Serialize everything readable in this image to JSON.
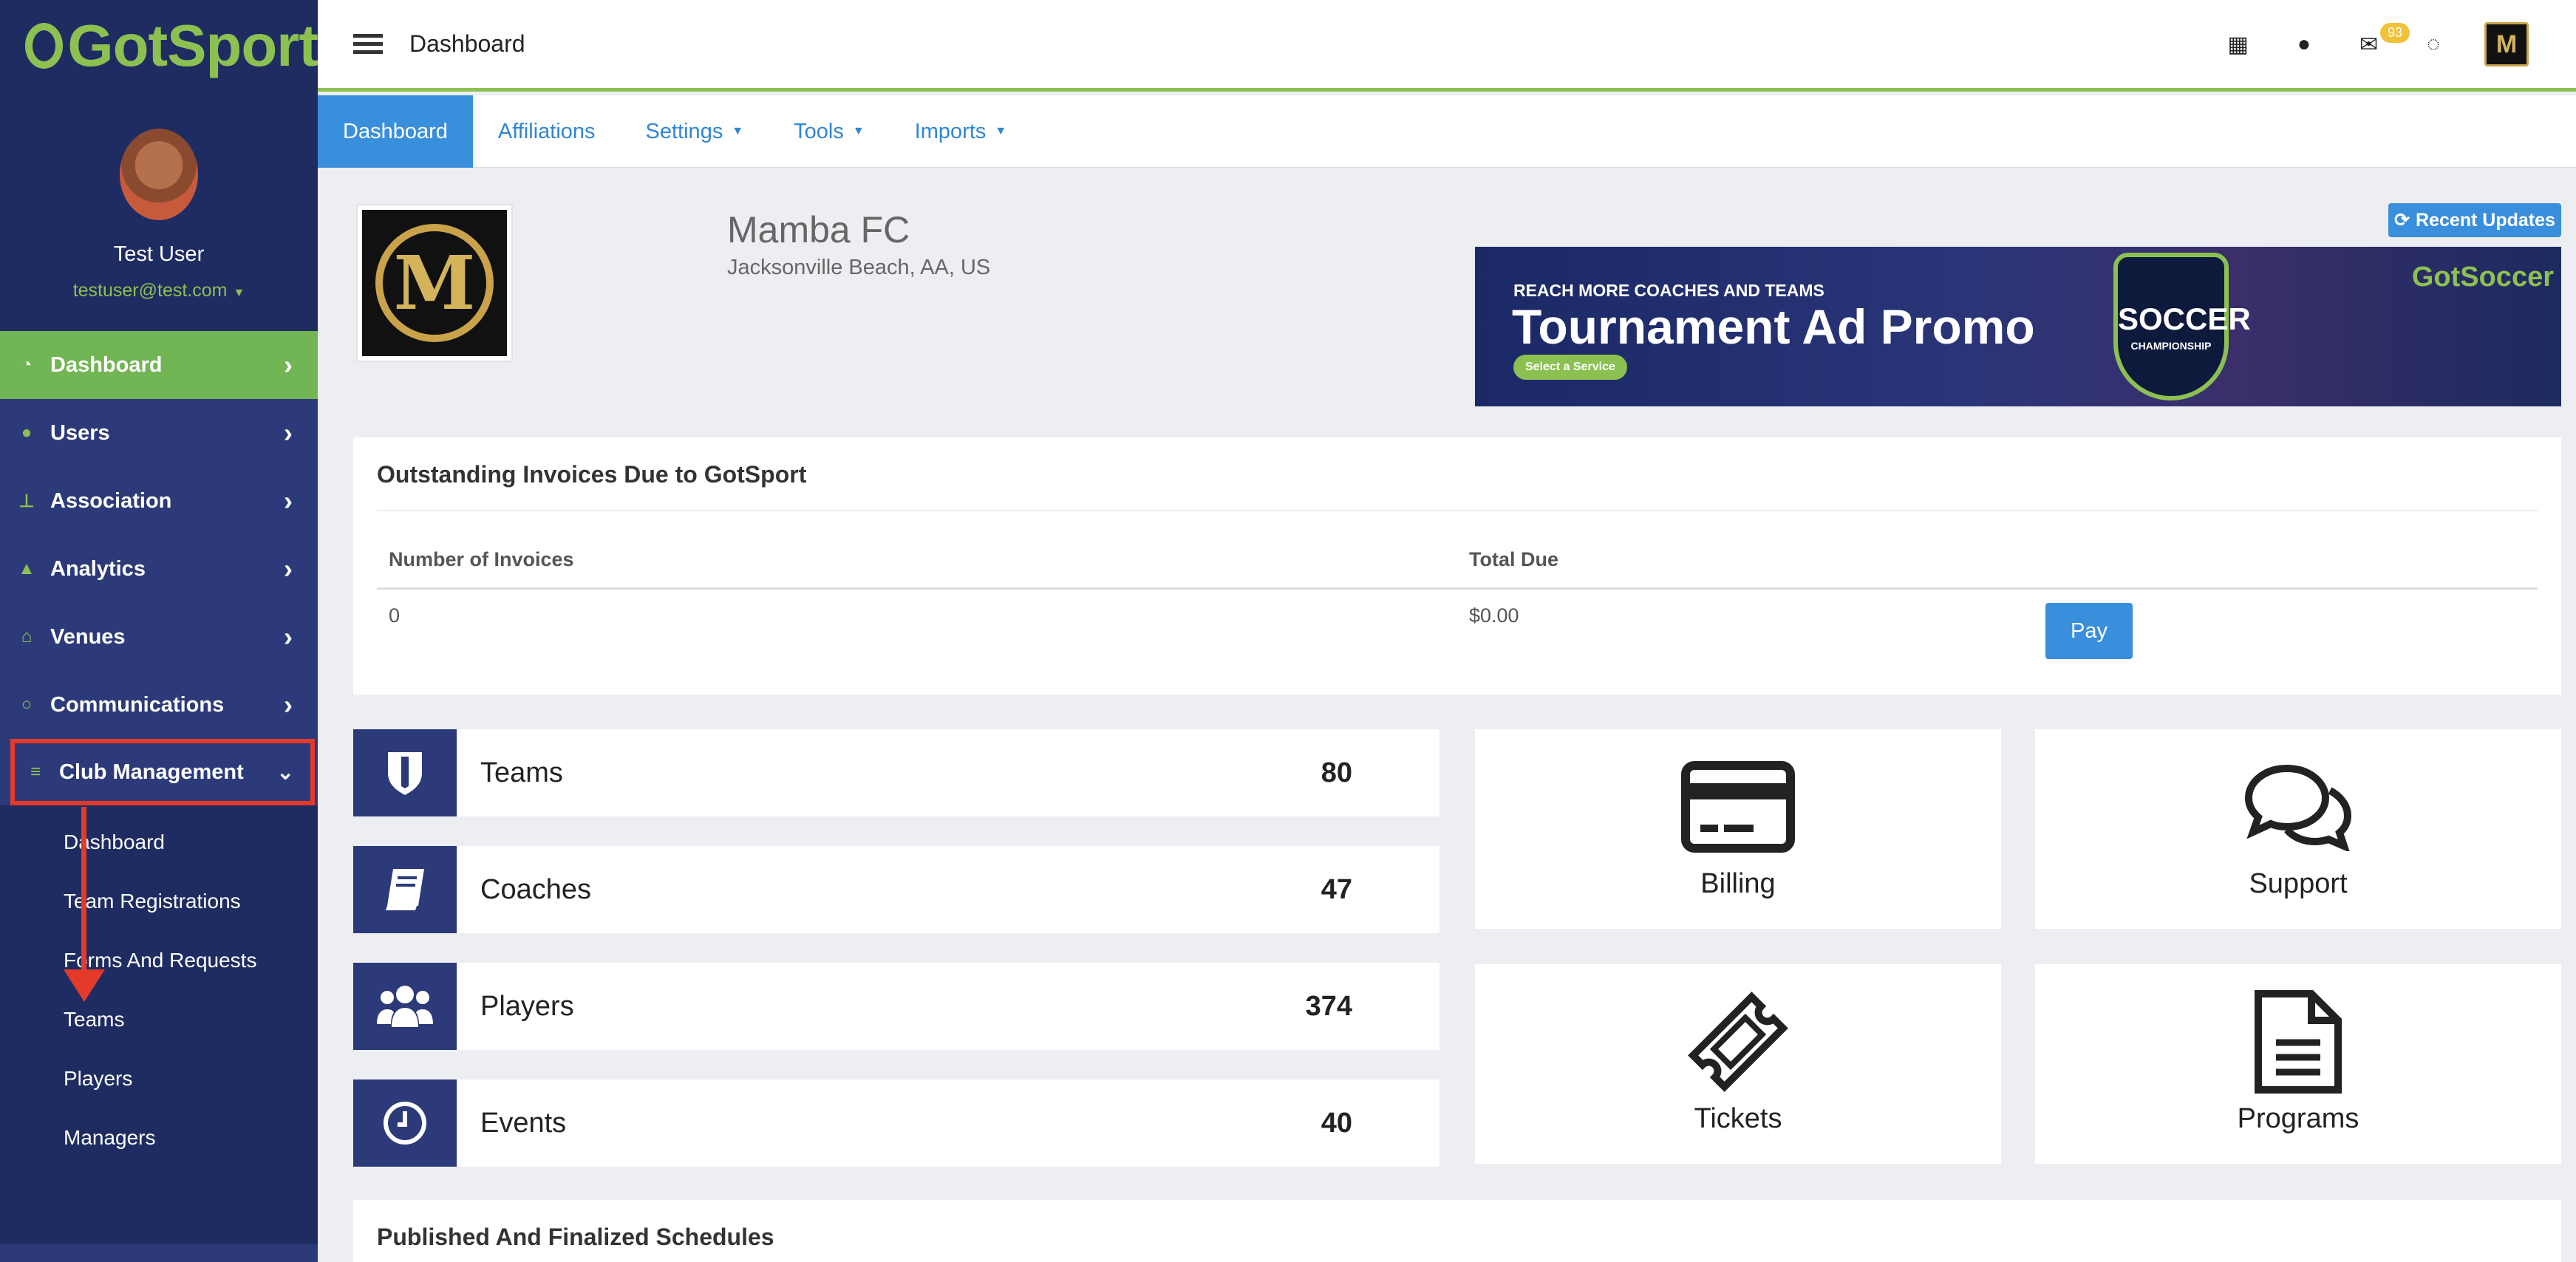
{
  "app": {
    "logo_text": "GotSport"
  },
  "user": {
    "name": "Test User",
    "email": "testuser@test.com"
  },
  "sidebar": {
    "items": [
      {
        "label": "Dashboard",
        "icon": "dashboard-icon"
      },
      {
        "label": "Users",
        "icon": "users-icon"
      },
      {
        "label": "Association",
        "icon": "sitemap-icon"
      },
      {
        "label": "Analytics",
        "icon": "chart-icon"
      },
      {
        "label": "Venues",
        "icon": "home-icon"
      },
      {
        "label": "Communications",
        "icon": "comments-icon"
      },
      {
        "label": "Club Management",
        "icon": "list-icon"
      }
    ],
    "submenu": [
      "Dashboard",
      "Team Registrations",
      "Forms And Requests",
      "Teams",
      "Players",
      "Managers"
    ]
  },
  "topbar": {
    "title": "Dashboard",
    "mail_badge": "93"
  },
  "tabs": [
    {
      "label": "Dashboard"
    },
    {
      "label": "Affiliations"
    },
    {
      "label": "Settings"
    },
    {
      "label": "Tools"
    },
    {
      "label": "Imports"
    }
  ],
  "club": {
    "name": "Mamba FC",
    "location": "Jacksonville Beach, AA, US",
    "logo_letter": "M"
  },
  "recent_updates_label": "Recent Updates",
  "ad": {
    "small": "REACH MORE COACHES AND TEAMS",
    "big": "Tournament Ad Promo",
    "button": "Select a Service",
    "brand": "GotSoccer",
    "badge_main": "SOCCER",
    "badge_sub": "CHAMPIONSHIP"
  },
  "invoices": {
    "title": "Outstanding Invoices Due to GotSport",
    "col_number": "Number of Invoices",
    "col_total": "Total Due",
    "number": "0",
    "total": "$0.00",
    "pay_label": "Pay"
  },
  "stats": [
    {
      "label": "Teams",
      "value": "80"
    },
    {
      "label": "Coaches",
      "value": "47"
    },
    {
      "label": "Players",
      "value": "374"
    },
    {
      "label": "Events",
      "value": "40"
    }
  ],
  "tiles": [
    {
      "label": "Billing",
      "icon": "credit-card-icon"
    },
    {
      "label": "Support",
      "icon": "comments-icon"
    },
    {
      "label": "Tickets",
      "icon": "ticket-icon"
    },
    {
      "label": "Programs",
      "icon": "file-icon"
    }
  ],
  "schedules_title": "Published And Finalized Schedules",
  "colors": {
    "sidebar": "#2c3a7a",
    "accent_green": "#8cc152",
    "primary_blue": "#3a8fdc",
    "highlight_red": "#e43a2a"
  }
}
